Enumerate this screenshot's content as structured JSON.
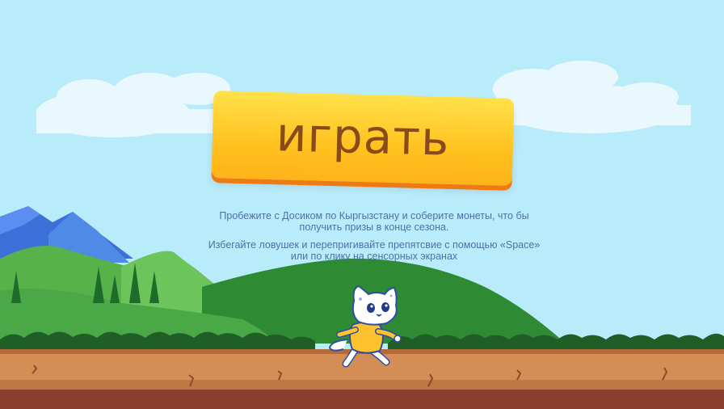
{
  "game": {
    "play_label": "играть",
    "description_1": "Пробежите с Досиком по Кыргызстану и соберите монеты, что бы получить призы в конце сезона.",
    "description_2": "Избегайте ловушек и перепригивайте препятсвие с помощью «Space» или по клику на сенсорных экранах"
  },
  "colors": {
    "sky": "#b9ecfb",
    "button_top": "#ffe14a",
    "button_bottom": "#ffb31a",
    "button_shadow": "#f07a12",
    "button_text": "#8a4b1c",
    "description_text": "#4f6fa6",
    "grass": "#3e9a3a",
    "ground": "#d48d55",
    "soil": "#8c3e2e"
  }
}
